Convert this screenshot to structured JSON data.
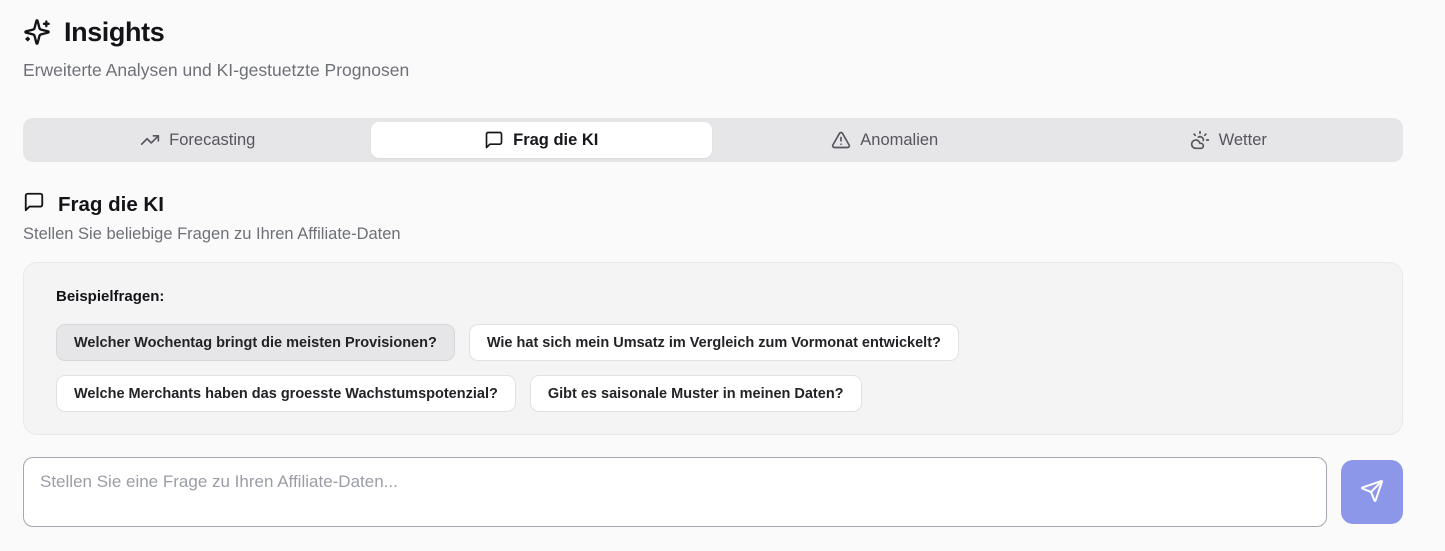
{
  "header": {
    "title": "Insights",
    "subtitle": "Erweiterte Analysen und KI-gestuetzte Prognosen"
  },
  "tabs": [
    {
      "label": "Forecasting",
      "icon": "trending-up-icon",
      "active": false
    },
    {
      "label": "Frag die KI",
      "icon": "message-square-icon",
      "active": true
    },
    {
      "label": "Anomalien",
      "icon": "alert-triangle-icon",
      "active": false
    },
    {
      "label": "Wetter",
      "icon": "cloud-sun-icon",
      "active": false
    }
  ],
  "section": {
    "title": "Frag die KI",
    "subtitle": "Stellen Sie beliebige Fragen zu Ihren Affiliate-Daten"
  },
  "examples": {
    "label": "Beispielfragen:",
    "questions": [
      "Welcher Wochentag bringt die meisten Provisionen?",
      "Wie hat sich mein Umsatz im Vergleich zum Vormonat entwickelt?",
      "Welche Merchants haben das groesste Wachstumspotenzial?",
      "Gibt es saisonale Muster in meinen Daten?"
    ]
  },
  "composer": {
    "placeholder": "Stellen Sie eine Frage zu Ihren Affiliate-Daten...",
    "value": "",
    "send_icon": "send-icon"
  },
  "colors": {
    "accent": "#8d97e9",
    "page_bg": "#fafafa",
    "tabbar_bg": "#e6e6e9",
    "card_bg": "#f4f4f5"
  }
}
